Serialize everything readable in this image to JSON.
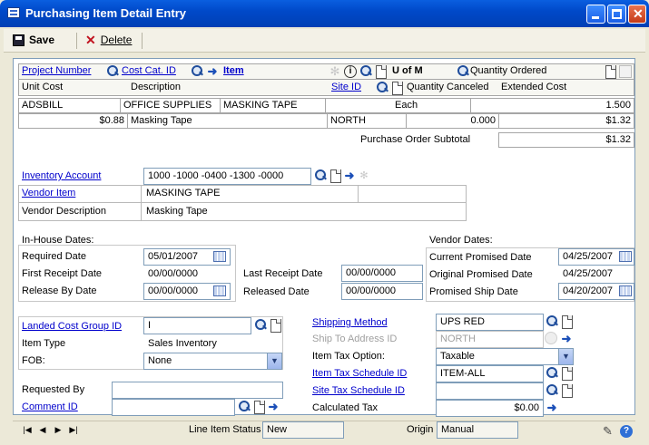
{
  "window": {
    "title": "Purchasing Item Detail Entry"
  },
  "toolbar": {
    "save_label": "Save",
    "delete_label": "Delete"
  },
  "grid": {
    "headers_row1": {
      "project_number": "Project Number",
      "cost_cat_id": "Cost Cat. ID",
      "item": "Item",
      "u_of_m": "U of M",
      "quantity_ordered": "Quantity Ordered"
    },
    "headers_row2": {
      "unit_cost": "Unit Cost",
      "description": "Description",
      "site_id": "Site ID",
      "quantity_canceled": "Quantity Canceled",
      "extended_cost": "Extended Cost"
    },
    "row1": {
      "project_number": "ADSBILL",
      "cost_cat_id": "OFFICE SUPPLIES",
      "item": "MASKING TAPE",
      "u_of_m": "Each",
      "quantity_ordered": "1.500"
    },
    "row2": {
      "unit_cost": "$0.88",
      "description": "Masking Tape",
      "site_id": "NORTH",
      "quantity_canceled": "0.000",
      "extended_cost": "$1.32"
    },
    "subtotal_label": "Purchase Order Subtotal",
    "subtotal_value": "$1.32"
  },
  "inventory": {
    "inventory_account_label": "Inventory Account",
    "inventory_account_value": "1000 -1000 -0400 -1300 -0000",
    "vendor_item_label": "Vendor Item",
    "vendor_item_value": "MASKING TAPE",
    "vendor_description_label": "Vendor Description",
    "vendor_description_value": "Masking Tape"
  },
  "dates": {
    "in_house_label": "In-House Dates:",
    "required_date_label": "Required Date",
    "required_date_value": "05/01/2007",
    "first_receipt_label": "First Receipt Date",
    "first_receipt_value": "00/00/0000",
    "release_by_label": "Release By Date",
    "release_by_value": "00/00/0000",
    "last_receipt_label": "Last Receipt Date",
    "last_receipt_value": "00/00/0000",
    "released_label": "Released Date",
    "released_value": "00/00/0000",
    "vendor_dates_label": "Vendor Dates:",
    "current_promised_label": "Current Promised Date",
    "current_promised_value": "04/25/2007",
    "original_promised_label": "Original Promised Date",
    "original_promised_value": "04/25/2007",
    "promised_ship_label": "Promised Ship Date",
    "promised_ship_value": "04/20/2007"
  },
  "details": {
    "landed_cost_label": "Landed Cost Group ID",
    "landed_cost_value": "I",
    "item_type_label": "Item Type",
    "item_type_value": "Sales Inventory",
    "fob_label": "FOB:",
    "fob_value": "None",
    "requested_by_label": "Requested By",
    "requested_by_value": "",
    "comment_id_label": "Comment ID",
    "comment_id_value": "",
    "shipping_method_label": "Shipping Method",
    "shipping_method_value": "UPS RED",
    "ship_to_label": "Ship To Address ID",
    "ship_to_value": "NORTH",
    "item_tax_option_label": "Item Tax Option:",
    "item_tax_option_value": "Taxable",
    "item_tax_schedule_label": "Item Tax Schedule ID",
    "item_tax_schedule_value": "ITEM-ALL",
    "site_tax_schedule_label": "Site Tax Schedule ID",
    "site_tax_schedule_value": "",
    "calculated_tax_label": "Calculated Tax",
    "calculated_tax_value": "$0.00"
  },
  "status": {
    "line_item_status_label": "Line Item Status",
    "line_item_status_value": "New",
    "origin_label": "Origin",
    "origin_value": "Manual"
  },
  "icons": [
    "lookup-icon",
    "new-document-icon",
    "expand-arrow-icon",
    "calendar-icon",
    "dropdown-icon",
    "info-icon",
    "help-icon"
  ]
}
